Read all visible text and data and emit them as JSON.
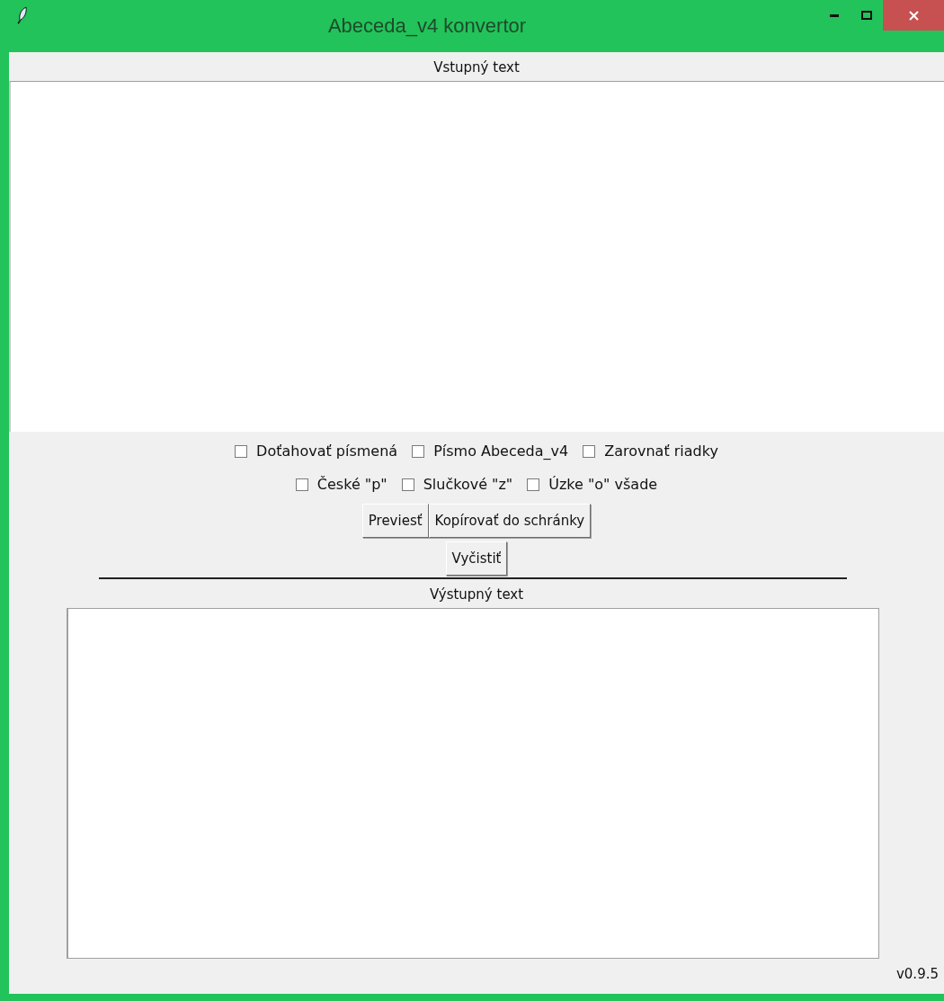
{
  "window": {
    "title": "Abeceda_v4 konvertor"
  },
  "input": {
    "label": "Vstupný text"
  },
  "option_rows": [
    [
      {
        "label": "Doťahovať písmená",
        "checked": false
      },
      {
        "label": "Písmo Abeceda_v4",
        "checked": false
      },
      {
        "label": "Zarovnať riadky",
        "checked": false
      }
    ],
    [
      {
        "label": "České \"p\"",
        "checked": false
      },
      {
        "label": "Slučkové \"z\"",
        "checked": false
      },
      {
        "label": "Úzke \"o\" všade",
        "checked": false
      }
    ]
  ],
  "button_rows": [
    [
      "Previesť",
      "Kopírovať do schránky"
    ],
    [
      "Vyčistiť"
    ]
  ],
  "output": {
    "label": "Výstupný text"
  },
  "version": "v0.9.5"
}
